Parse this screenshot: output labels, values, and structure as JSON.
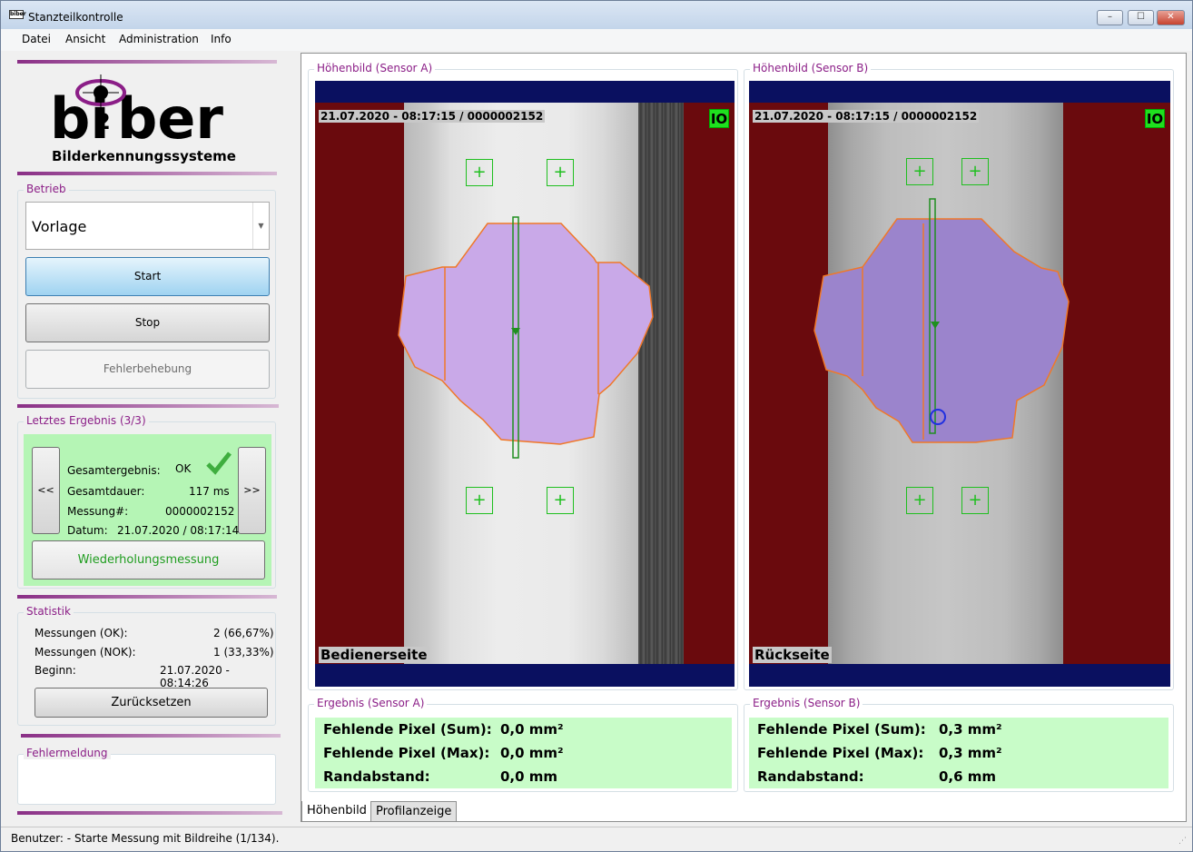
{
  "window": {
    "title": "Stanzteilkontrolle",
    "icon_text": "biber",
    "controls": {
      "minimize": "–",
      "maximize": "☐",
      "close": "✕"
    }
  },
  "menu": [
    "Datei",
    "Ansicht",
    "Administration",
    "Info"
  ],
  "logo": {
    "brand": "biber",
    "tagline": "Bilderkennungssysteme"
  },
  "betrieb": {
    "label": "Betrieb",
    "mode": "Vorlage",
    "start": "Start",
    "stop": "Stop",
    "fehler": "Fehlerbehebung"
  },
  "ergebnis": {
    "label": "Letztes Ergebnis (3/3)",
    "prev": "<<",
    "next": ">>",
    "gesamt_label": "Gesamtergebnis:",
    "gesamt_value": "OK",
    "dauer_label": "Gesamtdauer:",
    "dauer_value": "117 ms",
    "messung_label": "Messung#:",
    "messung_value": "0000002152",
    "datum_label": "Datum:",
    "datum_value": "21.07.2020 / 08:17:14",
    "repeat": "Wiederholungsmessung"
  },
  "statistik": {
    "label": "Statistik",
    "ok_label": "Messungen (OK):",
    "ok_value": "2 (66,67%)",
    "nok_label": "Messungen (NOK):",
    "nok_value": "1 (33,33%)",
    "begin_label": "Beginn:",
    "begin_value": "21.07.2020 - 08:14:26",
    "reset": "Zurücksetzen"
  },
  "fehlermeldung": {
    "label": "Fehlermeldung"
  },
  "sensor_a": {
    "label": "Höhenbild (Sensor A)",
    "timestamp": "21.07.2020 - 08:17:15 / 0000002152",
    "status": "IO",
    "side": "Bedienerseite",
    "result_label": "Ergebnis  (Sensor A)",
    "rows": [
      {
        "label": "Fehlende Pixel (Sum):",
        "value": "0,0 mm²"
      },
      {
        "label": "Fehlende Pixel (Max):",
        "value": "0,0 mm²"
      },
      {
        "label": "Randabstand:",
        "value": "0,0 mm"
      }
    ]
  },
  "sensor_b": {
    "label": "Höhenbild (Sensor B)",
    "timestamp": "21.07.2020 - 08:17:15 / 0000002152",
    "status": "IO",
    "side": "Rückseite",
    "result_label": "Ergebnis  (Sensor B)",
    "rows": [
      {
        "label": "Fehlende Pixel (Sum):",
        "value": "0,3 mm²"
      },
      {
        "label": "Fehlende Pixel (Max):",
        "value": "0,3 mm²"
      },
      {
        "label": "Randabstand:",
        "value": "0,6 mm"
      }
    ]
  },
  "tabs": [
    "Höhenbild",
    "Profilanzeige"
  ],
  "status": {
    "user": "Benutzer: -",
    "message": "Starte Messung mit Bildreihe (1/134)."
  },
  "colors": {
    "accent": "#8b1e87",
    "background": "#6a0a0d",
    "blueband": "#0a1060",
    "part_a": "#c9a9e8",
    "part_b": "#9b84cc",
    "result_bg": "#c8fcc8",
    "ok_check": "#3fae3f"
  }
}
